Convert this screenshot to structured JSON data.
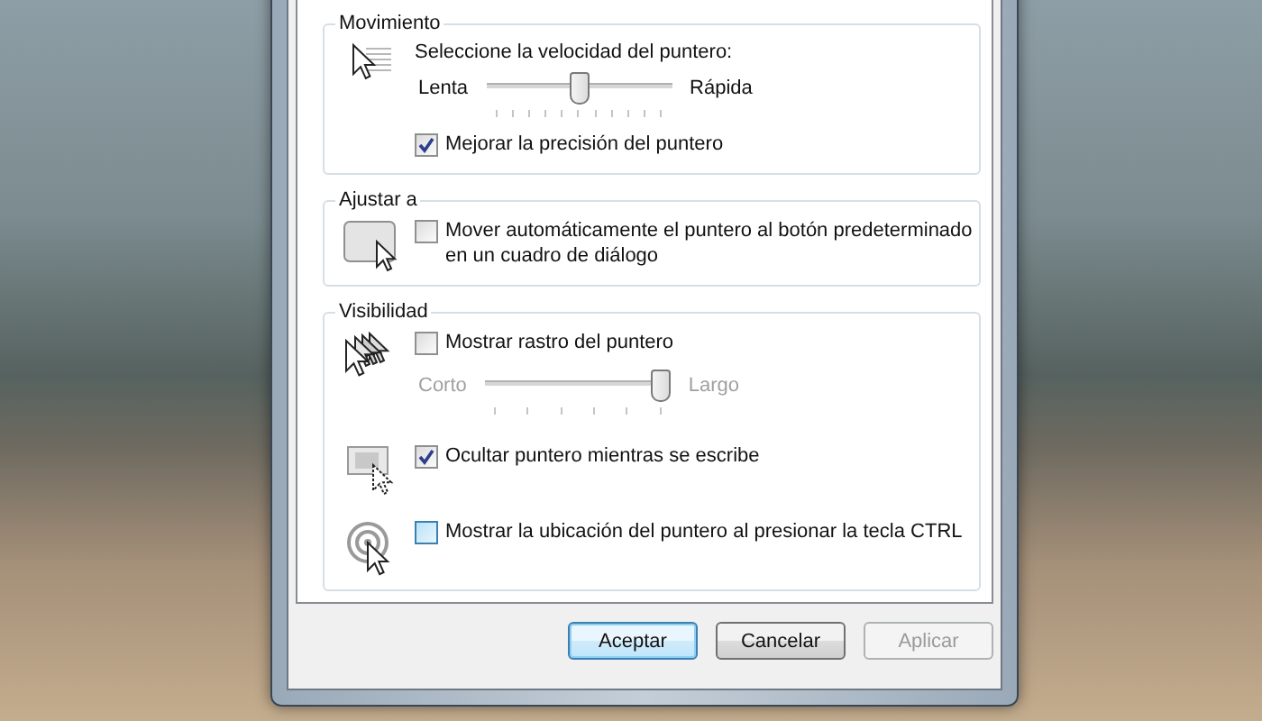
{
  "groups": [
    {
      "title": "Movimiento",
      "sections": [
        {
          "items": [
            {
              "kind": "label",
              "text": "Seleccione la velocidad del puntero:"
            },
            {
              "kind": "slider",
              "min_label": "Lenta",
              "max_label": "Rápida",
              "level": 0.5,
              "disabled": false
            },
            {
              "kind": "checkbox",
              "text": "Mejorar la precisión del puntero",
              "checked": true,
              "hovered": false
            }
          ]
        }
      ]
    },
    {
      "title": "Ajustar a",
      "sections": [
        {
          "items": [
            {
              "kind": "checkbox",
              "text": "Mover automáticamente el puntero al botón predeterminado en un cuadro de diálogo",
              "checked": false,
              "hovered": false
            }
          ]
        }
      ]
    },
    {
      "title": "Visibilidad",
      "sections": [
        {
          "items": [
            {
              "kind": "checkbox",
              "text": "Mostrar rastro del puntero",
              "checked": false,
              "hovered": false
            },
            {
              "kind": "slider",
              "min_label": "Corto",
              "max_label": "Largo",
              "level": 1,
              "disabled": true
            }
          ]
        },
        {
          "items": [
            {
              "kind": "checkbox",
              "text": "Ocultar puntero mientras se escribe",
              "checked": true,
              "hovered": false
            }
          ]
        },
        {
          "items": [
            {
              "kind": "checkbox",
              "text": "Mostrar la ubicación del puntero al presionar la tecla CTRL",
              "checked": false,
              "hovered": true
            }
          ]
        }
      ]
    }
  ],
  "buttons": [
    {
      "label": "Aceptar",
      "default": true,
      "disabled": false
    },
    {
      "label": "Cancelar",
      "default": false,
      "disabled": false
    },
    {
      "label": "Aplicar",
      "default": false,
      "disabled": true
    }
  ]
}
